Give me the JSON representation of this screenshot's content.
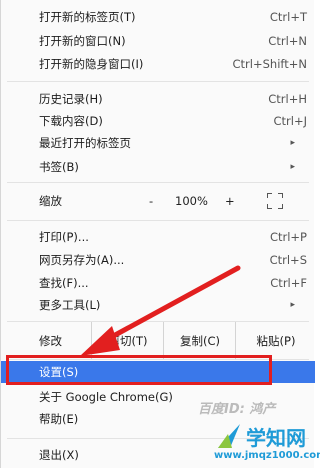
{
  "menu": {
    "new_tab": {
      "label": "打开新的标签页(T)",
      "shortcut": "Ctrl+T"
    },
    "new_window": {
      "label": "打开新的窗口(N)",
      "shortcut": "Ctrl+N"
    },
    "incognito": {
      "label": "打开新的隐身窗口(I)",
      "shortcut": "Ctrl+Shift+N"
    },
    "history": {
      "label": "历史记录(H)",
      "shortcut": "Ctrl+H"
    },
    "downloads": {
      "label": "下载内容(D)",
      "shortcut": "Ctrl+J"
    },
    "recent_tabs": {
      "label": "最近打开的标签页",
      "arrow": "▸"
    },
    "bookmarks": {
      "label": "书签(B)",
      "arrow": "▸"
    },
    "zoom": {
      "label": "缩放",
      "minus": "-",
      "value": "100%",
      "plus": "+"
    },
    "print": {
      "label": "打印(P)...",
      "shortcut": "Ctrl+P"
    },
    "save_as": {
      "label": "网页另存为(A)...",
      "shortcut": "Ctrl+S"
    },
    "find": {
      "label": "查找(F)...",
      "shortcut": "Ctrl+F"
    },
    "more_tools": {
      "label": "更多工具(L)",
      "arrow": "▸"
    },
    "edit": {
      "label": "修改",
      "cut": "剪切(T)",
      "copy": "复制(C)",
      "paste": "粘贴(P)"
    },
    "settings": {
      "label": "设置(S)"
    },
    "about": {
      "label": "关于 Google Chrome(G)"
    },
    "help": {
      "label": "帮助(E)"
    },
    "exit": {
      "label": "退出(X)"
    }
  },
  "watermark": {
    "text": "百度ID: 鸿产"
  },
  "logo": {
    "name": "学知网",
    "url": "www.jmqz1000.com"
  },
  "colors": {
    "highlight": "#3a78ea",
    "annotation_red": "#e21f1f",
    "logo_blue": "#1f9bd7"
  },
  "icons": {
    "fullscreen": "fullscreen-icon",
    "submenu": "chevron-right-icon",
    "annotation": "red-arrow"
  }
}
